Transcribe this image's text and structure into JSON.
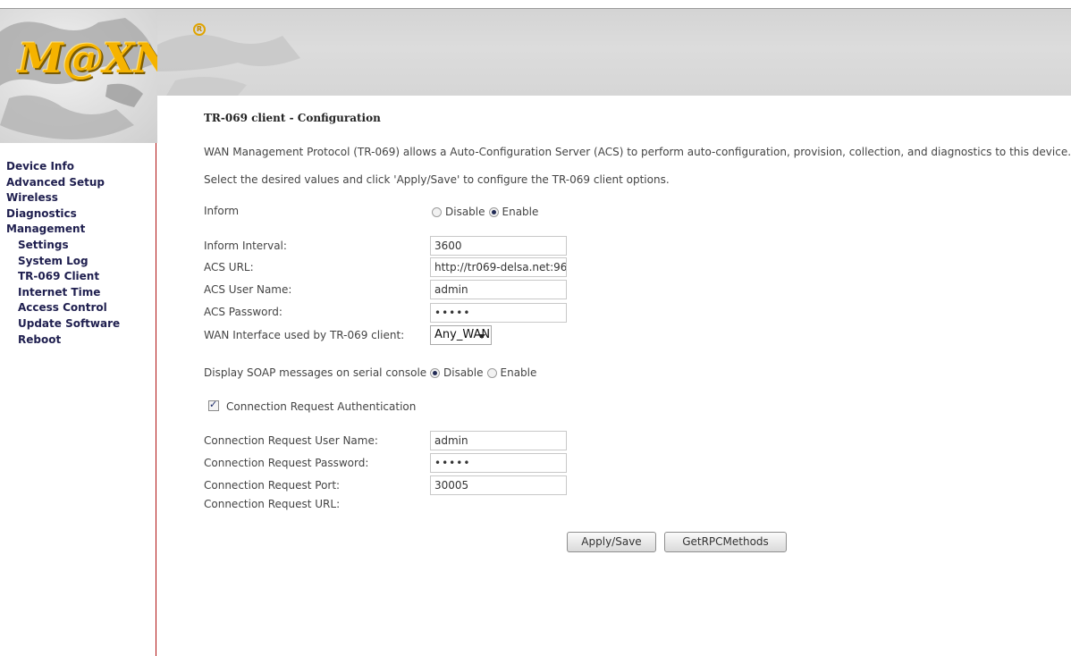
{
  "brand": {
    "logo_text": "M@XNET"
  },
  "nav": {
    "items": [
      {
        "label": "Device Info",
        "sub": false
      },
      {
        "label": "Advanced Setup",
        "sub": false
      },
      {
        "label": "Wireless",
        "sub": false
      },
      {
        "label": "Diagnostics",
        "sub": false
      },
      {
        "label": "Management",
        "sub": false
      },
      {
        "label": "Settings",
        "sub": true
      },
      {
        "label": "System Log",
        "sub": true
      },
      {
        "label": "TR-069 Client",
        "sub": true
      },
      {
        "label": "Internet Time",
        "sub": true
      },
      {
        "label": "Access Control",
        "sub": true
      },
      {
        "label": "Update Software",
        "sub": true
      },
      {
        "label": "Reboot",
        "sub": true
      }
    ]
  },
  "page": {
    "title": "TR-069 client - Configuration",
    "description": "WAN Management Protocol (TR-069) allows a Auto-Configuration Server (ACS) to perform auto-configuration, provision, collection, and diagnostics to this device.",
    "instruction": "Select the desired values and click 'Apply/Save' to configure the TR-069 client options."
  },
  "inform": {
    "label": "Inform",
    "options": [
      "Disable",
      "Enable"
    ],
    "selected": "Enable"
  },
  "fields": {
    "inform_interval": {
      "label": "Inform Interval:",
      "value": "3600"
    },
    "acs_url": {
      "label": "ACS URL:",
      "value": "http://tr069-delsa.net:96"
    },
    "acs_user": {
      "label": "ACS User Name:",
      "value": "admin"
    },
    "acs_password": {
      "label": "ACS Password:",
      "value": "•••••"
    },
    "wan_interface": {
      "label": "WAN Interface used by TR-069 client:",
      "value": "Any_WAN"
    }
  },
  "soap": {
    "label": "Display SOAP messages on serial console",
    "options": [
      "Disable",
      "Enable"
    ],
    "selected": "Disable"
  },
  "conn_auth": {
    "label": "Connection Request Authentication",
    "checked": true
  },
  "conn_fields": {
    "user": {
      "label": "Connection Request User Name:",
      "value": "admin"
    },
    "password": {
      "label": "Connection Request Password:",
      "value": "•••••"
    },
    "port": {
      "label": "Connection Request Port:",
      "value": "30005"
    },
    "url": {
      "label": "Connection Request URL:",
      "value": ""
    }
  },
  "buttons": {
    "apply": "Apply/Save",
    "rpc": "GetRPCMethods"
  },
  "colors": {
    "nav_text": "#1f1f4f",
    "sidebar_border": "#b01010",
    "logo": "#f5b300",
    "header_bg": "#d8d8d8"
  }
}
